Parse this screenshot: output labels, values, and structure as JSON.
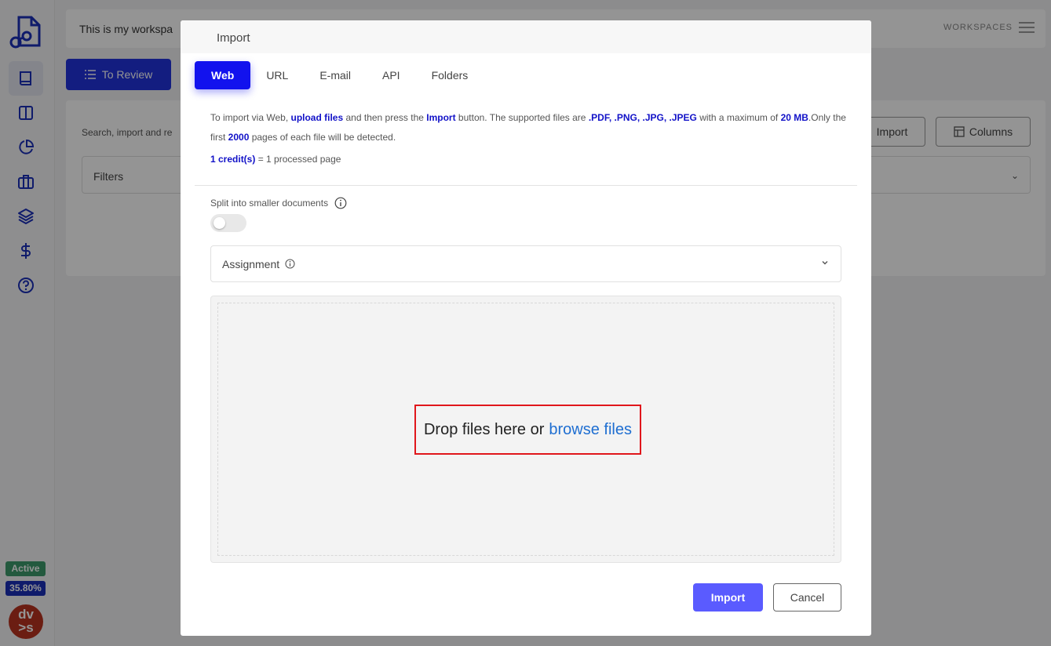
{
  "sidebar": {
    "logo_icon": "logo-icon",
    "items": [
      {
        "name": "book-icon",
        "active": true
      },
      {
        "name": "columns-icon",
        "active": false
      },
      {
        "name": "pie-chart-icon",
        "active": false
      },
      {
        "name": "briefcase-icon",
        "active": false
      },
      {
        "name": "layers-icon",
        "active": false
      },
      {
        "name": "dollar-icon",
        "active": false
      },
      {
        "name": "help-icon",
        "active": false
      }
    ],
    "status_badge": "Active",
    "usage_badge": "35.80%",
    "avatar_initials_1": "dv",
    "avatar_initials_2": ">s"
  },
  "header": {
    "workspace_title": "This is my workspa",
    "workspaces_label": "WORKSPACES"
  },
  "toolbar": {
    "to_review_label": "To Review",
    "search_text": "Search, import and re",
    "import_label": "Import",
    "columns_label": "Columns",
    "filters_label": "Filters"
  },
  "modal": {
    "title": "Import",
    "tabs": [
      {
        "label": "Web",
        "active": true
      },
      {
        "label": "URL",
        "active": false
      },
      {
        "label": "E-mail",
        "active": false
      },
      {
        "label": "API",
        "active": false
      },
      {
        "label": "Folders",
        "active": false
      }
    ],
    "info": {
      "part1": "To import via Web, ",
      "upload_files": "upload files",
      "part2": " and then press the ",
      "import_word": "Import",
      "part3": " button. The supported files are ",
      "formats": ".PDF, .PNG, .JPG, .JPEG",
      "part4": " with a maximum of ",
      "max_size": "20 MB",
      "part5": ".Only the first ",
      "max_pages": "2000",
      "part6": " pages of each file will be detected."
    },
    "credits": {
      "value": "1 credit(s)",
      "rest": " = 1 processed page"
    },
    "split_label": "Split into smaller documents",
    "split_enabled": false,
    "assignment_label": "Assignment",
    "dropzone": {
      "text": "Drop files here or",
      "link": "browse files"
    },
    "import_button": "Import",
    "cancel_button": "Cancel"
  },
  "colors": {
    "accent": "#1212ee",
    "import_button": "#5a5bff",
    "highlight_border": "#e0161b",
    "link": "#1e6ed1"
  }
}
